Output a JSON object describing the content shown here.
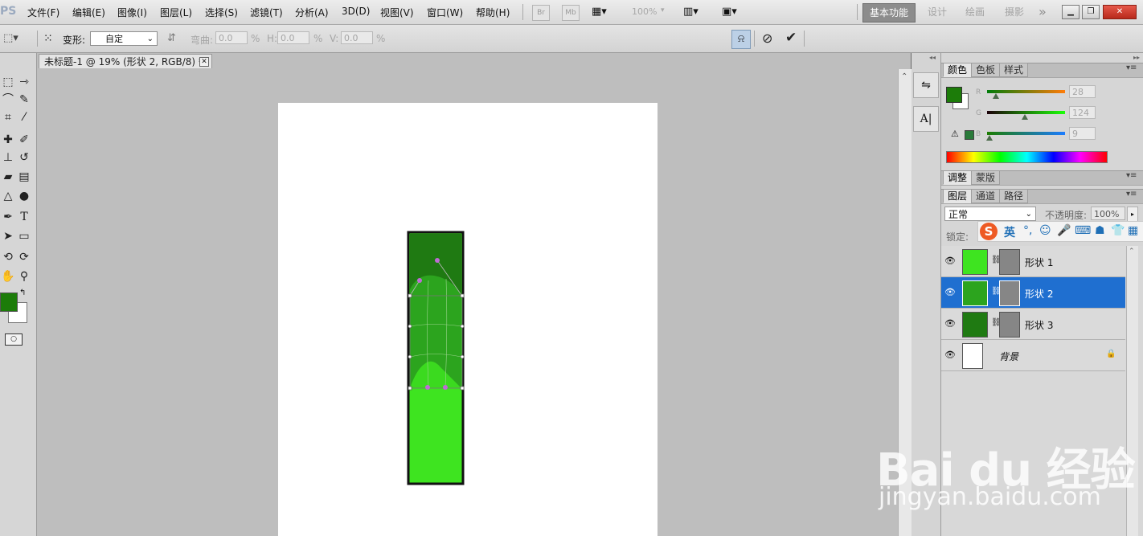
{
  "menubar": {
    "logo": "PS",
    "items": [
      "文件(F)",
      "编辑(E)",
      "图像(I)",
      "图层(L)",
      "选择(S)",
      "滤镜(T)",
      "分析(A)",
      "3D(D)",
      "视图(V)",
      "窗口(W)",
      "帮助(H)"
    ],
    "br": "Br",
    "mb": "Mb",
    "zoom": "100%",
    "workspaces": [
      "基本功能",
      "设计",
      "绘画",
      "摄影"
    ],
    "more": "»"
  },
  "options": {
    "transform_label": "变形:",
    "transform_value": "自定",
    "bend_label": "弯曲:",
    "bend_value": "0.0",
    "h_label": "H:",
    "h_value": "0.0",
    "v_label": "V:",
    "v_value": "0.0",
    "percent": "%"
  },
  "document": {
    "tab_title": "未标题-1 @ 19% (形状 2, RGB/8) *"
  },
  "colors": {
    "foreground": "#1c7c09",
    "background": "#ffffff",
    "shape_dark": "#1f7a12",
    "shape_mid": "#2ca41e",
    "shape_light": "#3ee420",
    "selection": "#1f6fd0"
  },
  "color_panel": {
    "tabs": [
      "颜色",
      "色板",
      "样式"
    ],
    "r_label": "R",
    "g_label": "G",
    "b_label": "B",
    "r": 28,
    "g": 124,
    "b": 9
  },
  "adjust_panel": {
    "tabs": [
      "调整",
      "蒙版"
    ]
  },
  "layers_panel": {
    "tabs": [
      "图层",
      "通道",
      "路径"
    ],
    "blend_mode": "正常",
    "opacity_label": "不透明度:",
    "opacity_value": "100%",
    "lock_label": "锁定:",
    "layers": [
      {
        "name": "形状 1",
        "color": "#3ee420",
        "selected": false
      },
      {
        "name": "形状 2",
        "color": "#2ca41e",
        "selected": true
      },
      {
        "name": "形状 3",
        "color": "#1f7a12",
        "selected": false
      },
      {
        "name": "背景",
        "color": "#ffffff",
        "selected": false
      }
    ]
  },
  "ime": {
    "mode": "英"
  },
  "watermark": {
    "logo": "Bai du 经验",
    "url": "jingyan.baidu.com"
  }
}
